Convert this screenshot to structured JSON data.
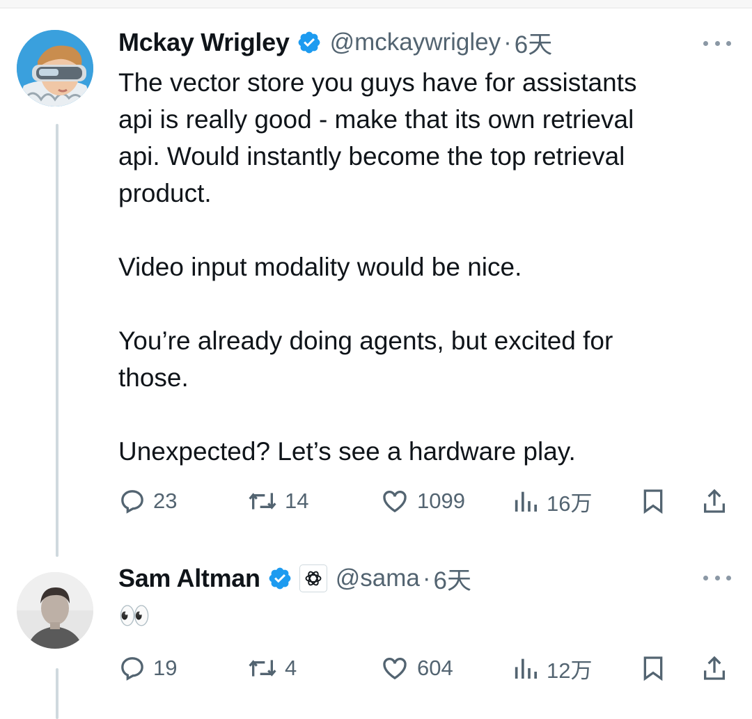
{
  "tweets": [
    {
      "name": "Mckay Wrigley",
      "handle": "@mckaywrigley",
      "sep": "·",
      "time": "6天",
      "body": [
        "The vector store you guys have for assistants",
        "api is really good - make that its own retrieval",
        "api. Would instantly become the top retrieval",
        "product.",
        "",
        "Video input modality would be nice.",
        "",
        "You’re already doing agents, but excited for",
        "those.",
        "",
        "Unexpected? Let’s see a hardware play."
      ],
      "replies": "23",
      "reposts": "14",
      "likes": "1099",
      "views": "16万"
    },
    {
      "name": "Sam Altman",
      "handle": "@sama",
      "sep": "·",
      "time": "6天",
      "body": [
        "👀"
      ],
      "replies": "19",
      "reposts": "4",
      "likes": "604",
      "views": "12万"
    }
  ],
  "icons": {
    "verified": "verified-badge-icon",
    "affiliate": "openai-logo-icon",
    "more": "more-options-icon",
    "reply": "reply-icon",
    "repost": "repost-icon",
    "like": "like-icon",
    "views": "views-icon",
    "bookmark": "bookmark-icon",
    "share": "share-icon"
  },
  "colors": {
    "verified": "#1d9bf0",
    "text": "#0f1419",
    "secondary": "#536471",
    "thread": "#cfd9de"
  }
}
